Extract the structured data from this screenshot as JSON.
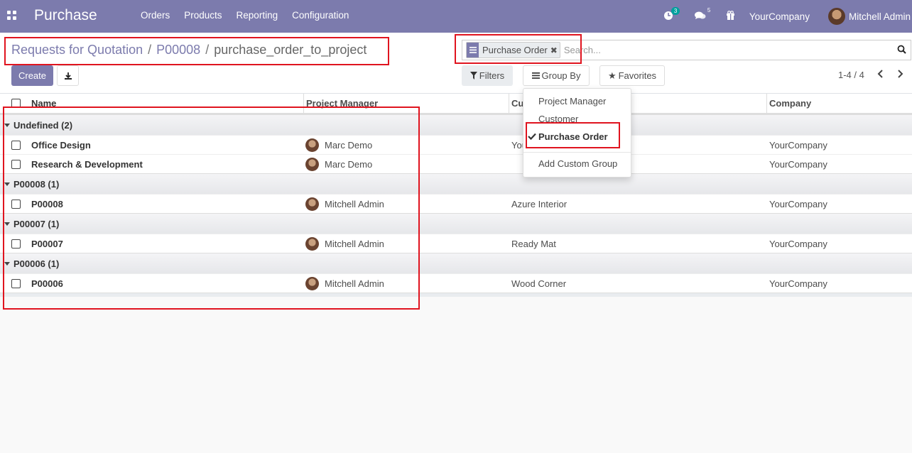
{
  "navbar": {
    "app_name": "Purchase",
    "menu": [
      "Orders",
      "Products",
      "Reporting",
      "Configuration"
    ],
    "activity_count": "3",
    "messages_count": "5",
    "company": "YourCompany",
    "user": "Mitchell Admin",
    "bg_color": "#7c7bad"
  },
  "breadcrumb": {
    "items": [
      "Requests for Quotation",
      "P00008"
    ],
    "current": "purchase_order_to_project"
  },
  "toolbar": {
    "create_label": "Create",
    "download_icon": "download-icon"
  },
  "search": {
    "facet_label": "Purchase Order",
    "placeholder": "Search..."
  },
  "filters": {
    "filters_label": "Filters",
    "group_by_label": "Group By",
    "favorites_label": "Favorites"
  },
  "pager": {
    "value": "1-4 / 4"
  },
  "group_by_menu": {
    "items": [
      "Project Manager",
      "Customer",
      "Purchase Order"
    ],
    "checked": "Purchase Order",
    "custom_group_label": "Add Custom Group"
  },
  "table": {
    "headers": [
      "Name",
      "Project Manager",
      "Cu",
      "Company"
    ],
    "groups": [
      {
        "label": "Undefined (2)",
        "rows": [
          {
            "name": "Office Design",
            "manager": "Marc Demo",
            "customer": "You",
            "company": "YourCompany"
          },
          {
            "name": "Research & Development",
            "manager": "Marc Demo",
            "customer": "",
            "company": "YourCompany"
          }
        ]
      },
      {
        "label": "P00008 (1)",
        "rows": [
          {
            "name": "P00008",
            "manager": "Mitchell Admin",
            "customer": "Azure Interior",
            "company": "YourCompany"
          }
        ]
      },
      {
        "label": "P00007 (1)",
        "rows": [
          {
            "name": "P00007",
            "manager": "Mitchell Admin",
            "customer": "Ready Mat",
            "company": "YourCompany"
          }
        ]
      },
      {
        "label": "P00006 (1)",
        "rows": [
          {
            "name": "P00006",
            "manager": "Mitchell Admin",
            "customer": "Wood Corner",
            "company": "YourCompany"
          }
        ]
      }
    ]
  },
  "colors": {
    "accent": "#7c7bad",
    "highlight": "#e0141f"
  }
}
